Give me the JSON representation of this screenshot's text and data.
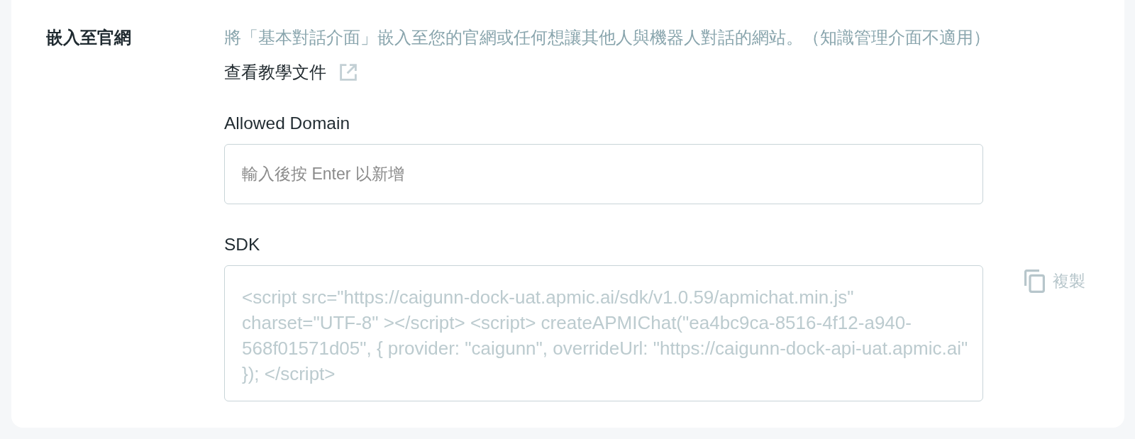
{
  "section": {
    "title": "嵌入至官網",
    "description": "將「基本對話介面」嵌入至您的官網或任何想讓其他人與機器人對話的網站。（知識管理介面不適用）",
    "tutorial_link": "查看教學文件"
  },
  "allowed_domain": {
    "label": "Allowed Domain",
    "placeholder": "輸入後按 Enter 以新增"
  },
  "sdk": {
    "label": "SDK",
    "value": "<script src=\"https://caigunn-dock-uat.apmic.ai/sdk/v1.0.59/apmichat.min.js\" charset=\"UTF-8\" ></script> <script> createAPMIChat(\"ea4bc9ca-8516-4f12-a940-568f01571d05\", { provider: \"caigunn\", overrideUrl: \"https://caigunn-dock-api-uat.apmic.ai\" }); </script>",
    "disabled": true
  },
  "copy_button": {
    "label": "複製",
    "disabled": true
  }
}
